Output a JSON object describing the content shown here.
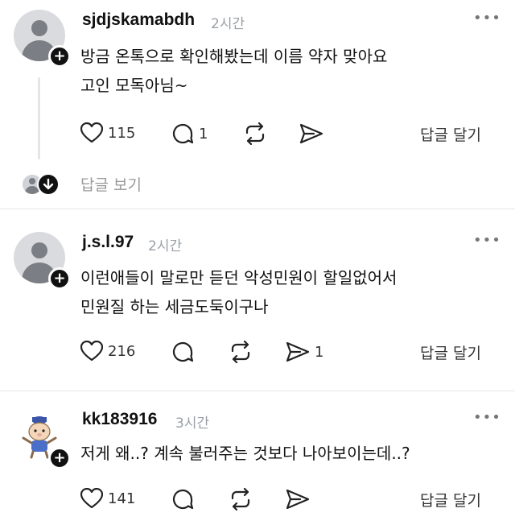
{
  "comments": [
    {
      "username": "sjdjskamabdh",
      "time": "2시간",
      "lines": [
        "방금 온톡으로 확인해봤는데 이름 약자 맞아요",
        "고인 모독아님~"
      ],
      "likes": "115",
      "replies": "1",
      "reposts": "",
      "shares": "",
      "reply_label": "답글 달기",
      "avatar": "default-avatar"
    },
    {
      "username": "j.s.l.97",
      "time": "2시간",
      "lines": [
        "이런애들이 말로만 듣던 악성민원이 할일없어서",
        "민원질 하는 세금도둑이구나"
      ],
      "likes": "216",
      "replies": "",
      "reposts": "",
      "shares": "1",
      "reply_label": "답글 달기",
      "avatar": "default-avatar"
    },
    {
      "username": "kk183916",
      "time": "3시간",
      "lines": [
        "저게 왜..? 계속 불러주는 것보다 나아보이는데..?"
      ],
      "likes": "141",
      "replies": "",
      "reposts": "",
      "shares": "",
      "reply_label": "답글 달기",
      "avatar": "cartoon-avatar"
    }
  ],
  "thread": {
    "view_replies_label": "답글 보기"
  },
  "icons": {
    "like": "heart-icon",
    "comment": "comment-bubble-icon",
    "repost": "repost-icon",
    "share": "send-icon",
    "more": "more-dots-icon",
    "follow": "plus-icon"
  },
  "colors": {
    "text": "#111111",
    "meta": "#9aa0a6",
    "divider": "#e6e6e6"
  }
}
